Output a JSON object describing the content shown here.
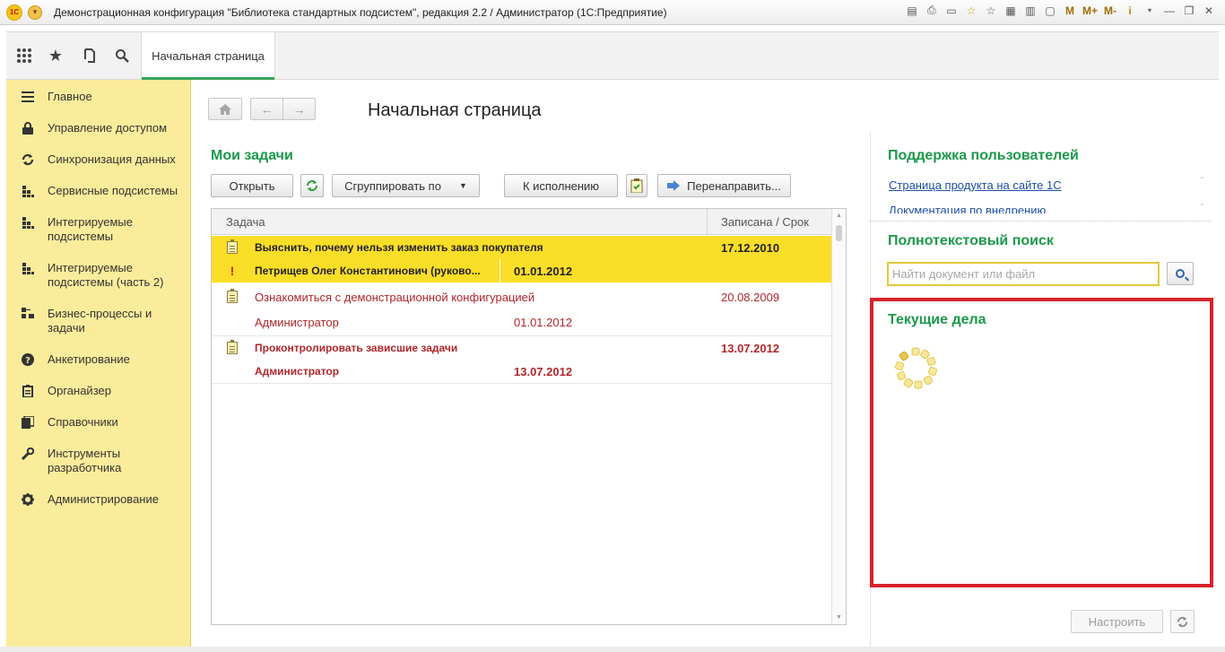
{
  "window": {
    "title": "Демонстрационная конфигурация \"Библиотека стандартных подсистем\", редакция 2.2 / Администратор  (1С:Предприятие)",
    "logo": "1С",
    "toolbar": [
      "M",
      "M+",
      "M-",
      "i"
    ]
  },
  "panel": {
    "tab_label": "Начальная страница"
  },
  "sidebar": {
    "items": [
      {
        "label": "Главное",
        "icon": "menu-icon"
      },
      {
        "label": "Управление доступом",
        "icon": "lock-icon"
      },
      {
        "label": "Синхронизация данных",
        "icon": "sync-icon"
      },
      {
        "label": "Сервисные подсистемы",
        "icon": "grid-icon"
      },
      {
        "label": "Интегрируемые подсистемы",
        "icon": "grid-icon"
      },
      {
        "label": "Интегрируемые подсистемы (часть 2)",
        "icon": "grid-icon"
      },
      {
        "label": "Бизнес-процессы и задачи",
        "icon": "business-icon"
      },
      {
        "label": "Анкетирование",
        "icon": "question-icon"
      },
      {
        "label": "Органайзер",
        "icon": "clipboard-icon"
      },
      {
        "label": "Справочники",
        "icon": "books-icon"
      },
      {
        "label": "Инструменты разработчика",
        "icon": "wrench-icon"
      },
      {
        "label": "Администрирование",
        "icon": "gear-icon"
      }
    ]
  },
  "main": {
    "page_title": "Начальная страница",
    "my_tasks": {
      "title": "Мои задачи",
      "buttons": {
        "open": "Открыть",
        "group_by": "Сгруппировать по",
        "to_execute": "К исполнению",
        "redirect": "Перенаправить..."
      },
      "columns": [
        "Задача",
        "Записана / Срок"
      ],
      "rows": [
        {
          "task": "Выяснить, почему нельзя изменить заказ покупателя",
          "date": "17.12.2010",
          "sub": "Петрищев Олег Константинович (руково...",
          "sub_date": "01.01.2012"
        },
        {
          "task": "Ознакомиться с демонстрационной конфигурацией",
          "date": "20.08.2009",
          "sub": "Администратор",
          "sub_date": "01.01.2012"
        },
        {
          "task": "Проконтролировать зависшие задачи",
          "date": "13.07.2012",
          "sub": "Администратор",
          "sub_date": "13.07.2012"
        }
      ]
    },
    "support": {
      "title": "Поддержка пользователей",
      "links": [
        "Страница продукта на сайте 1С",
        "Документация по внедрению"
      ]
    },
    "fulltext_search": {
      "title": "Полнотекстовый поиск",
      "placeholder": "Найти документ или файл"
    },
    "current_affairs": {
      "title": "Текущие дела"
    },
    "configure_button": "Настроить"
  },
  "colors": {
    "sidebar_bg": "#fbec9b",
    "section_green": "#1b9a4a",
    "highlight_row": "#fbde27",
    "task_red": "#b3262b",
    "alert_border": "#d9222a"
  }
}
